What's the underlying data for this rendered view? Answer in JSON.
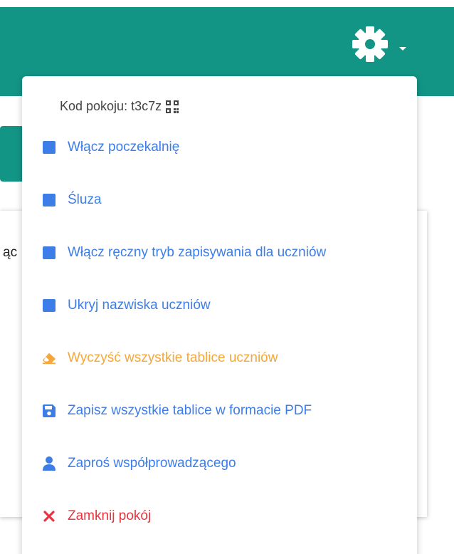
{
  "colors": {
    "header_bg": "#139585",
    "menu_blue": "#3d7de8",
    "menu_orange": "#f4a73a",
    "menu_red": "#e7343f",
    "text_gray": "#444444"
  },
  "header": {
    "settings_icon": "gear-icon",
    "dropdown_caret": "chevron-down-icon"
  },
  "background": {
    "partial_text": "ąc"
  },
  "menu": {
    "room_code_label": "Kod pokoju: t3c7z",
    "room_code_icon": "qr-code-icon",
    "items": [
      {
        "label": "Włącz poczekalnię",
        "icon": "checkbox-icon",
        "color": "#3d7de8"
      },
      {
        "label": "Śluza",
        "icon": "checkbox-icon",
        "color": "#3d7de8"
      },
      {
        "label": "Włącz ręczny tryb zapisywania dla uczniów",
        "icon": "checkbox-icon",
        "color": "#3d7de8"
      },
      {
        "label": "Ukryj nazwiska uczniów",
        "icon": "checkbox-icon",
        "color": "#3d7de8"
      },
      {
        "label": "Wyczyść wszystkie tablice uczniów",
        "icon": "eraser-icon",
        "color": "#f4a73a"
      },
      {
        "label": "Zapisz wszystkie tablice w formacie PDF",
        "icon": "save-icon",
        "color": "#3d7de8"
      },
      {
        "label": "Zaproś współprowadzącego",
        "icon": "user-icon",
        "color": "#3d7de8"
      },
      {
        "label": "Zamknij pokój",
        "icon": "close-icon",
        "color": "#e7343f"
      }
    ]
  }
}
